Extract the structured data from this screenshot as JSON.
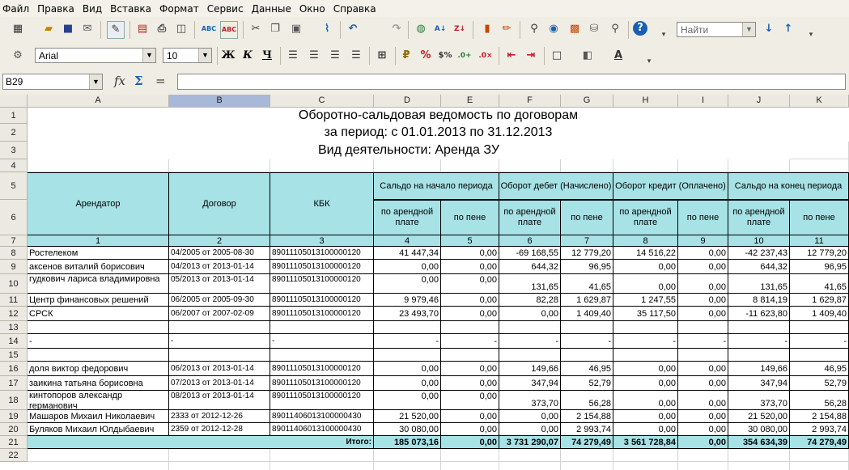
{
  "menu": [
    "Файл",
    "Правка",
    "Вид",
    "Вставка",
    "Формат",
    "Сервис",
    "Данные",
    "Окно",
    "Справка"
  ],
  "toolbar": {
    "find_placeholder": "Найти",
    "font_name": "Arial",
    "font_size": "10",
    "bold": "Ж",
    "italic": "К",
    "underline": "Ч"
  },
  "formula_bar": {
    "name_box": "B29",
    "fx": "fx",
    "sum": "Σ",
    "equals": "=",
    "value": ""
  },
  "columns": [
    "A",
    "B",
    "C",
    "D",
    "E",
    "F",
    "G",
    "H",
    "I",
    "J",
    "K"
  ],
  "selected_column": "B",
  "rows": [
    "1",
    "2",
    "3",
    "4",
    "5",
    "6",
    "7",
    "8",
    "9",
    "10",
    "11",
    "12",
    "13",
    "14",
    "15",
    "16",
    "17",
    "18",
    "19",
    "20",
    "21",
    "22"
  ],
  "sheet": {
    "title": "Оборотно-сальдовая ведомость по договорам",
    "period": "за период: с 01.01.2013  по 31.12.2013",
    "activity": "Вид деятельности: Аренда ЗУ",
    "headers": {
      "tenant": "Арендатор",
      "contract": "Договор",
      "kbk": "КБК",
      "open_balance": "Сальдо на начало периода",
      "debit_turnover": "Оборот дебет (Начислено)",
      "credit_turnover": "Оборот кредит (Оплачено)",
      "close_balance": "Сальдо на конец периода",
      "rent": "по арендной плате",
      "penalty": "по пене"
    },
    "col_numbers": [
      "1",
      "2",
      "3",
      "4",
      "5",
      "6",
      "7",
      "8",
      "9",
      "10",
      "11"
    ],
    "data_rows": [
      {
        "row": "8",
        "tenant": "Ростелеком",
        "contract": "04/2005 от 2005-08-30",
        "kbk": "89011105013100000120",
        "v": [
          "41 447,34",
          "0,00",
          "-69 168,55",
          "12 779,20",
          "14 516,22",
          "0,00",
          "-42 237,43",
          "12 779,20"
        ]
      },
      {
        "row": "9",
        "tenant": "аксенов виталий борисович",
        "contract": "04/2013 от 2013-01-14",
        "kbk": "89011105013100000120",
        "v": [
          "0,00",
          "0,00",
          "644,32",
          "96,95",
          "0,00",
          "0,00",
          "644,32",
          "96,95"
        ]
      },
      {
        "row": "10",
        "tenant": "гудкович лариса владимировна",
        "contract": "05/2013 от 2013-01-14",
        "kbk": "89011105013100000120",
        "v": [
          "0,00",
          "0,00",
          "131,65",
          "41,65",
          "0,00",
          "0,00",
          "131,65",
          "41,65"
        ]
      },
      {
        "row": "11",
        "tenant": "Центр финансовых решений",
        "contract": "06/2005 от 2005-09-30",
        "kbk": "89011105013100000120",
        "v": [
          "9 979,46",
          "0,00",
          "82,28",
          "1 629,87",
          "1 247,55",
          "0,00",
          "8 814,19",
          "1 629,87"
        ]
      },
      {
        "row": "12",
        "tenant": "СРСК",
        "contract": "06/2007 от 2007-02-09",
        "kbk": "89011105013100000120",
        "v": [
          "23 493,70",
          "0,00",
          "0,00",
          "1 409,40",
          "35 117,50",
          "0,00",
          "-11 623,80",
          "1 409,40"
        ]
      },
      {
        "row": "13",
        "tenant": "",
        "contract": "",
        "kbk": "",
        "v": [
          "",
          "",
          "",
          "",
          "",
          "",
          "",
          ""
        ]
      },
      {
        "row": "14",
        "tenant": "-",
        "contract": "-",
        "kbk": "-",
        "v": [
          "-",
          "-",
          "-",
          "-",
          "-",
          "-",
          "-",
          "-"
        ]
      },
      {
        "row": "15",
        "tenant": "",
        "contract": "",
        "kbk": "",
        "v": [
          "",
          "",
          "",
          "",
          "",
          "",
          "",
          ""
        ]
      },
      {
        "row": "16",
        "tenant": "доля виктор федорович",
        "contract": "06/2013 от 2013-01-14",
        "kbk": "89011105013100000120",
        "v": [
          "0,00",
          "0,00",
          "149,66",
          "46,95",
          "0,00",
          "0,00",
          "149,66",
          "46,95"
        ]
      },
      {
        "row": "17",
        "tenant": "заикина татьяна борисовна",
        "contract": "07/2013 от 2013-01-14",
        "kbk": "89011105013100000120",
        "v": [
          "0,00",
          "0,00",
          "347,94",
          "52,79",
          "0,00",
          "0,00",
          "347,94",
          "52,79"
        ]
      },
      {
        "row": "18",
        "tenant": "кинтопоров александр германович",
        "contract": "08/2013 от 2013-01-14",
        "kbk": "89011105013100000120",
        "v": [
          "0,00",
          "0,00",
          "373,70",
          "56,28",
          "0,00",
          "0,00",
          "373,70",
          "56,28"
        ]
      },
      {
        "row": "19",
        "tenant": "Машаров Михаил Николаевич",
        "contract": "2333 от 2012-12-26",
        "kbk": "89011406013100000430",
        "v": [
          "21 520,00",
          "0,00",
          "0,00",
          "2 154,88",
          "0,00",
          "0,00",
          "21 520,00",
          "2 154,88"
        ]
      },
      {
        "row": "20",
        "tenant": "Буляков Михаил Юлдыбаевич",
        "contract": "2359 от 2012-12-28",
        "kbk": "89011406013100000430",
        "v": [
          "30 080,00",
          "0,00",
          "0,00",
          "2 993,74",
          "0,00",
          "0,00",
          "30 080,00",
          "2 993,74"
        ]
      }
    ],
    "total": {
      "label": "Итого:",
      "v": [
        "185 073,16",
        "0,00",
        "3 731 290,07",
        "74 279,49",
        "3 561 728,84",
        "0,00",
        "354 634,39",
        "74 279,49"
      ]
    }
  }
}
